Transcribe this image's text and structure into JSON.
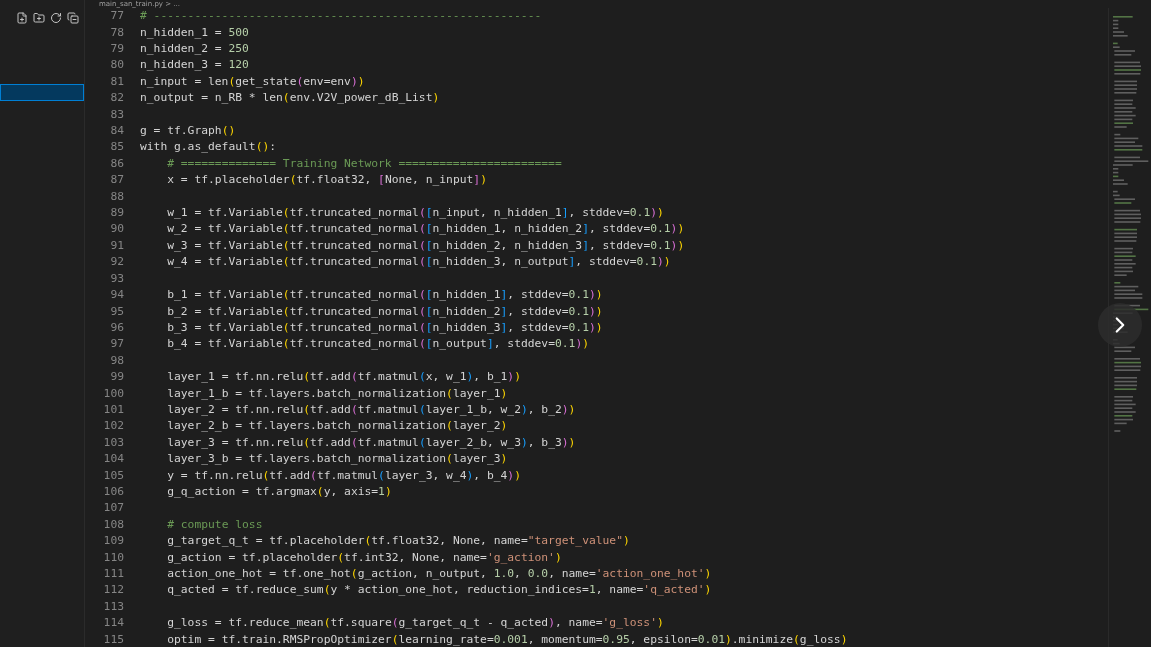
{
  "breadcrumb": "main_san_train.py > ...",
  "sidebar": {
    "rows": [
      {
        "selected": true
      }
    ]
  },
  "editor": {
    "lines": [
      {
        "number": "77",
        "text": "# ---------------------------------------------------------"
      },
      {
        "number": "78",
        "text": "n_hidden_1 = 500"
      },
      {
        "number": "79",
        "text": "n_hidden_2 = 250"
      },
      {
        "number": "80",
        "text": "n_hidden_3 = 120"
      },
      {
        "number": "81",
        "text": "n_input = len(get_state(env=env))"
      },
      {
        "number": "82",
        "text": "n_output = n_RB * len(env.V2V_power_dB_List)"
      },
      {
        "number": "83"
      },
      {
        "number": "84",
        "text": "g = tf.Graph()"
      },
      {
        "number": "85",
        "text": "with g.as_default():"
      },
      {
        "number": "86",
        "text": "    # ============== Training Network ========================"
      },
      {
        "number": "87",
        "text": "    x = tf.placeholder(tf.float32, [None, n_input])"
      },
      {
        "number": "88"
      },
      {
        "number": "89",
        "text": "    w_1 = tf.Variable(tf.truncated_normal([n_input, n_hidden_1], stddev=0.1))"
      },
      {
        "number": "90",
        "text": "    w_2 = tf.Variable(tf.truncated_normal([n_hidden_1, n_hidden_2], stddev=0.1))"
      },
      {
        "number": "91",
        "text": "    w_3 = tf.Variable(tf.truncated_normal([n_hidden_2, n_hidden_3], stddev=0.1))"
      },
      {
        "number": "92",
        "text": "    w_4 = tf.Variable(tf.truncated_normal([n_hidden_3, n_output], stddev=0.1))"
      },
      {
        "number": "93"
      },
      {
        "number": "94",
        "text": "    b_1 = tf.Variable(tf.truncated_normal([n_hidden_1], stddev=0.1))"
      },
      {
        "number": "95",
        "text": "    b_2 = tf.Variable(tf.truncated_normal([n_hidden_2], stddev=0.1))"
      },
      {
        "number": "96",
        "text": "    b_3 = tf.Variable(tf.truncated_normal([n_hidden_3], stddev=0.1))"
      },
      {
        "number": "97",
        "text": "    b_4 = tf.Variable(tf.truncated_normal([n_output], stddev=0.1))"
      },
      {
        "number": "98"
      },
      {
        "number": "99",
        "text": "    layer_1 = tf.nn.relu(tf.add(tf.matmul(x, w_1), b_1))"
      },
      {
        "number": "100",
        "text": "    layer_1_b = tf.layers.batch_normalization(layer_1)"
      },
      {
        "number": "101",
        "text": "    layer_2 = tf.nn.relu(tf.add(tf.matmul(layer_1_b, w_2), b_2))"
      },
      {
        "number": "102",
        "text": "    layer_2_b = tf.layers.batch_normalization(layer_2)"
      },
      {
        "number": "103",
        "text": "    layer_3 = tf.nn.relu(tf.add(tf.matmul(layer_2_b, w_3), b_3))"
      },
      {
        "number": "104",
        "text": "    layer_3_b = tf.layers.batch_normalization(layer_3)"
      },
      {
        "number": "105",
        "text": "    y = tf.nn.relu(tf.add(tf.matmul(layer_3, w_4), b_4))"
      },
      {
        "number": "106",
        "text": "    g_q_action = tf.argmax(y, axis=1)"
      },
      {
        "number": "107"
      },
      {
        "number": "108",
        "text": "    # compute loss"
      },
      {
        "number": "109",
        "text": "    g_target_q_t = tf.placeholder(tf.float32, None, name=\"target_value\")"
      },
      {
        "number": "110",
        "text": "    g_action = tf.placeholder(tf.int32, None, name='g_action')"
      },
      {
        "number": "111",
        "text": "    action_one_hot = tf.one_hot(g_action, n_output, 1.0, 0.0, name='action_one_hot')"
      },
      {
        "number": "112",
        "text": "    q_acted = tf.reduce_sum(y * action_one_hot, reduction_indices=1, name='q_acted')"
      },
      {
        "number": "113"
      },
      {
        "number": "114",
        "text": "    g_loss = tf.reduce_mean(tf.square(g_target_q_t - q_acted), name='g_loss')"
      },
      {
        "number": "115",
        "text": "    optim = tf.train.RMSPropOptimizer(learning_rate=0.001, momentum=0.95, epsilon=0.01).minimize(g_loss)"
      }
    ]
  }
}
